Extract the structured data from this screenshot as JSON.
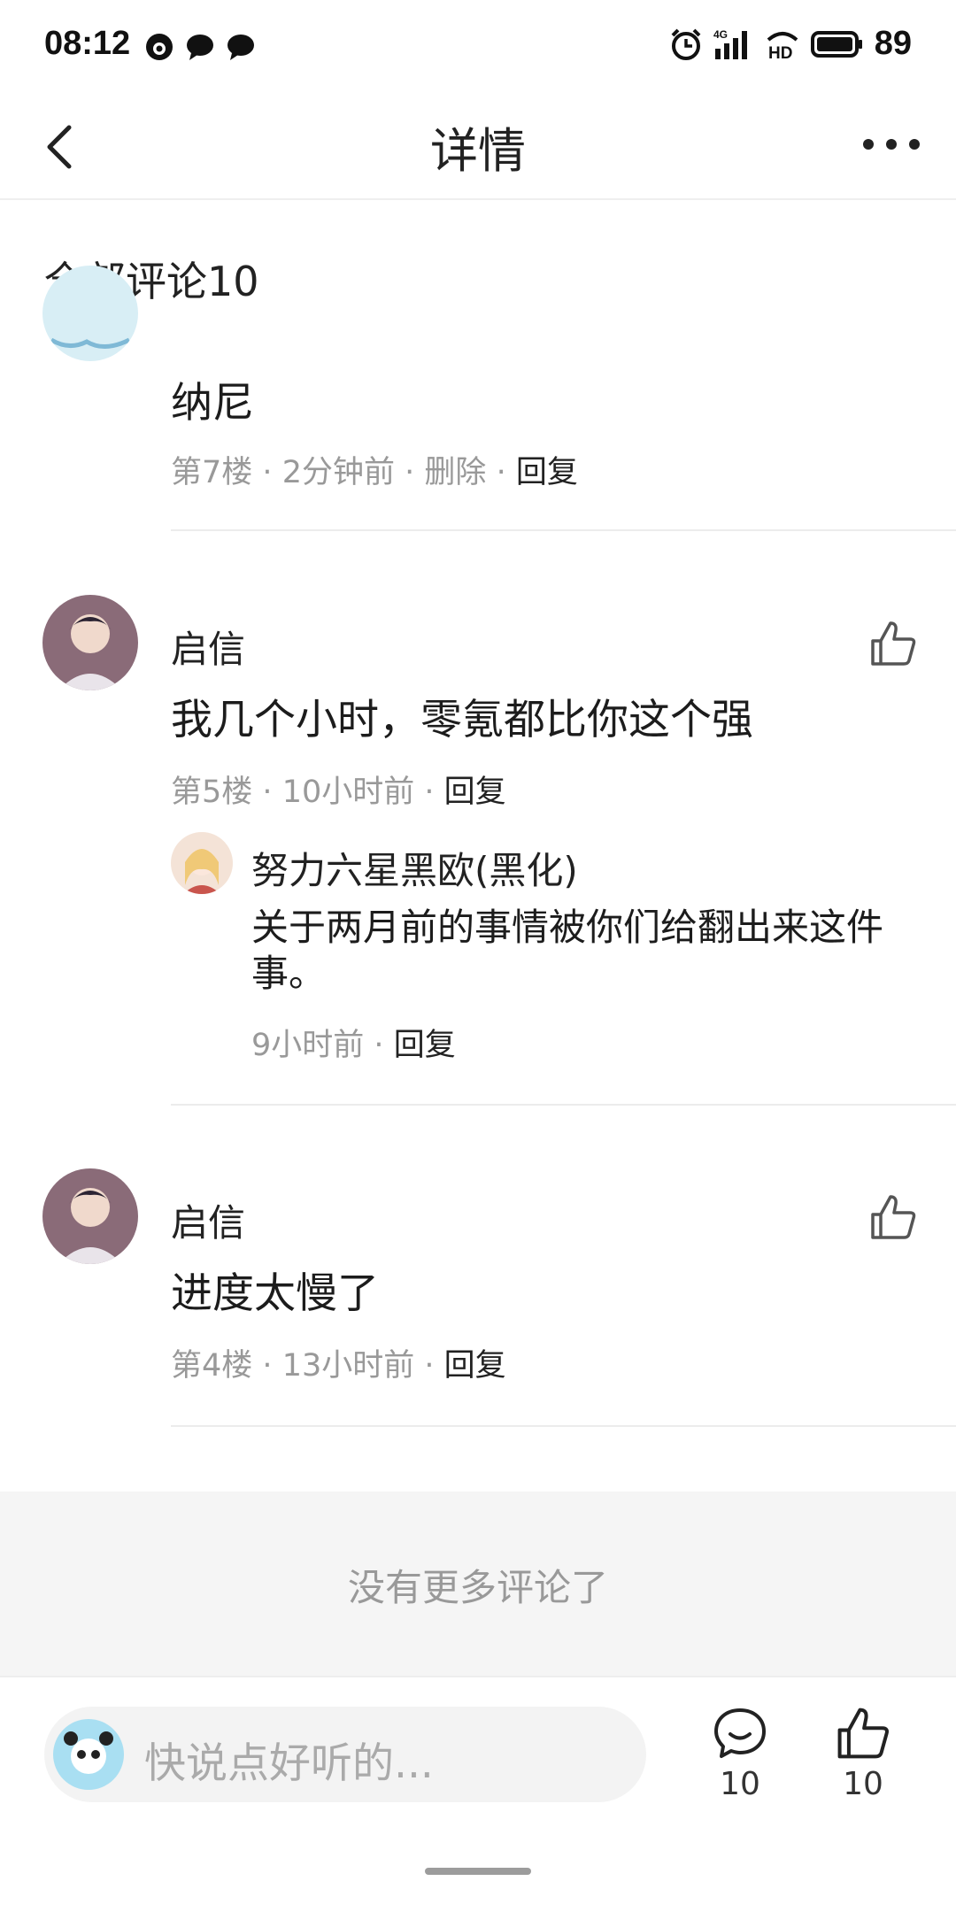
{
  "status_bar": {
    "time": "08:12",
    "battery": "89",
    "icons": [
      "chat-bubble-icon",
      "message-icon",
      "message-icon",
      "alarm-icon",
      "signal-4g-icon",
      "hd-icon",
      "battery-icon"
    ]
  },
  "nav": {
    "title": "详情",
    "back_icon": "chevron-left-icon",
    "more_icon": "more-dots-icon"
  },
  "comments_header": "全部评论10",
  "comments": [
    {
      "text": "纳尼",
      "meta": {
        "floor": "第7楼",
        "time": "2分钟前",
        "delete": "删除",
        "reply": "回复"
      }
    },
    {
      "name": "启信",
      "text": "我几个小时，零氪都比你这个强",
      "meta": {
        "floor": "第5楼",
        "time": "10小时前",
        "reply": "回复"
      },
      "sub_reply": {
        "name": "努力六星黑欧(黑化)",
        "text": "关于两月前的事情被你们给翻出来这件事。",
        "meta": {
          "time": "9小时前",
          "reply": "回复"
        }
      }
    },
    {
      "name": "启信",
      "text": "进度太慢了",
      "meta": {
        "floor": "第4楼",
        "time": "13小时前",
        "reply": "回复"
      }
    }
  ],
  "meta_separator": "·",
  "no_more": "没有更多评论了",
  "bottom_bar": {
    "placeholder": "快说点好听的...",
    "comment_count": "10",
    "like_count": "10"
  },
  "colors": {
    "text_primary": "#222222",
    "text_secondary": "#999999",
    "divider": "#ececec",
    "no_more_bg": "#f5f5f5",
    "input_bg": "#f3f3f3"
  }
}
